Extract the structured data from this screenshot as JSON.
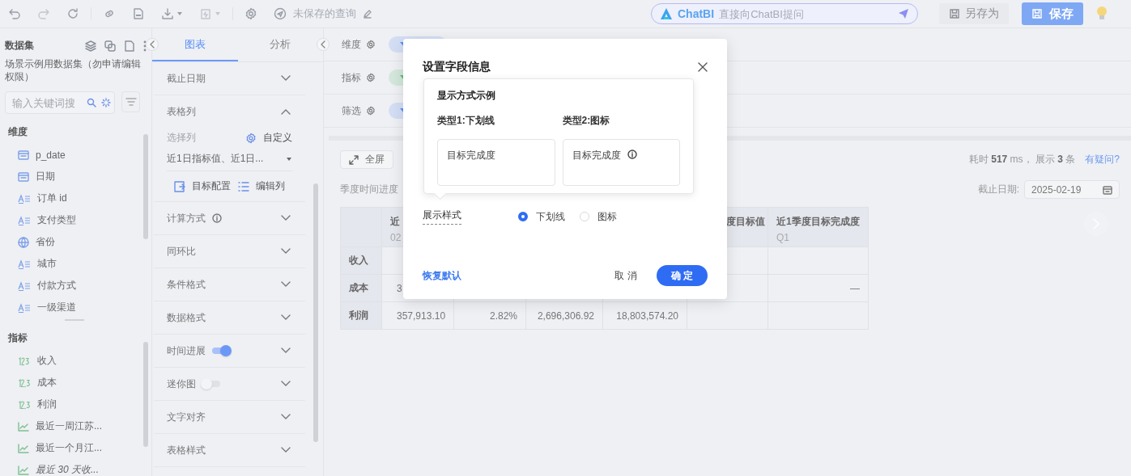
{
  "toolbar": {
    "query_title": "未保存的查询",
    "chatbi": {
      "brand": "ChatBI",
      "placeholder": "直接向ChatBI提问"
    },
    "save_as": {
      "label": "另存为",
      "disabled": true
    },
    "save": {
      "label": "保存"
    }
  },
  "dataset_panel": {
    "title": "数据集",
    "dataset_name": "场景示例用数据集（勿申请编辑权限）",
    "search": {
      "placeholder": "输入关键词搜"
    },
    "dimensions": {
      "title": "维度",
      "items": [
        {
          "label": "p_date",
          "kind": "date"
        },
        {
          "label": "日期",
          "kind": "date"
        },
        {
          "label": "订单 id",
          "kind": "text"
        },
        {
          "label": "支付类型",
          "kind": "text"
        },
        {
          "label": "省份",
          "kind": "geo"
        },
        {
          "label": "城市",
          "kind": "text"
        },
        {
          "label": "付款方式",
          "kind": "text"
        },
        {
          "label": "一级渠道",
          "kind": "text"
        }
      ]
    },
    "metrics": {
      "title": "指标",
      "items": [
        {
          "label": "收入",
          "kind": "integer"
        },
        {
          "label": "成本",
          "kind": "decimal"
        },
        {
          "label": "利润",
          "kind": "decimal"
        },
        {
          "label": "最近一周江苏...",
          "kind": "trend"
        },
        {
          "label": "最近一个月江...",
          "kind": "trend"
        },
        {
          "label": "最近 30 天收...",
          "kind": "trend_italic"
        }
      ]
    }
  },
  "config_panel": {
    "tabs": [
      {
        "label": "图表",
        "selected": true
      },
      {
        "label": "分析",
        "selected": false
      }
    ],
    "sections": [
      {
        "label": "截止日期",
        "kind": "plain",
        "expanded": false
      },
      {
        "label": "表格列",
        "kind": "columns",
        "expanded": true,
        "select_label": "选择列",
        "custom_label": "自定义",
        "selected_columns": "近1日指标值、近1日...",
        "actions": [
          "目标配置",
          "编辑列"
        ]
      },
      {
        "label": "计算方式",
        "kind": "info",
        "expanded": false
      },
      {
        "label": "同环比",
        "kind": "plain",
        "expanded": false
      },
      {
        "label": "条件格式",
        "kind": "plain",
        "expanded": false
      },
      {
        "label": "数据格式",
        "kind": "plain",
        "expanded": false
      },
      {
        "label": "时间进展",
        "kind": "switch",
        "on": true,
        "expanded": false
      },
      {
        "label": "迷你图",
        "kind": "switch",
        "on": false,
        "expanded": false
      },
      {
        "label": "文字对齐",
        "kind": "plain",
        "expanded": false
      },
      {
        "label": "表格样式",
        "kind": "plain",
        "expanded": false
      }
    ]
  },
  "query_bar": {
    "rows": [
      {
        "label": "维度",
        "color": "#5b8ff9"
      },
      {
        "label": "指标",
        "color": "#5ac26e"
      },
      {
        "label": "筛选",
        "color": "#5b8ff9"
      }
    ]
  },
  "results": {
    "fullscreen": "全屏",
    "stats": "耗时 **517** ms， 展示 **3** 条",
    "help_link": "有疑问?",
    "table_title": "季度时间进度",
    "date_filter": {
      "label": "截止日期:",
      "value": "2025-02-19"
    },
    "table": {
      "columns": [
        {
          "title": "近",
          "subtitle": "02"
        },
        {},
        {},
        {},
        {
          "title": "度目标值"
        },
        {
          "title": "近1季度目标完成度",
          "subtitle": "Q1"
        }
      ],
      "rows": [
        {
          "label": "收入",
          "cells": [
            null,
            null,
            null,
            null,
            null,
            null
          ]
        },
        {
          "label": "成本",
          "cells": [
            "3",
            null,
            null,
            null,
            null,
            "—"
          ]
        },
        {
          "label": "利润",
          "cells": [
            "357,913.10",
            "2.82%",
            "2,696,306.92",
            "18,803,574.20",
            null,
            null
          ]
        }
      ]
    }
  },
  "modal": {
    "title": "设置字段信息",
    "example": {
      "title": "显示方式示例",
      "types": [
        {
          "label": "类型1:下划线",
          "sample": "目标完成度",
          "kind": "underline"
        },
        {
          "label": "类型2:图标",
          "sample": "目标完成度",
          "kind": "icon"
        }
      ]
    },
    "style_label": "展示样式",
    "options": [
      {
        "label": "下划线",
        "selected": true
      },
      {
        "label": "图标",
        "selected": false
      }
    ],
    "reset": "恢复默认",
    "cancel": "取 消",
    "confirm": "确 定"
  }
}
